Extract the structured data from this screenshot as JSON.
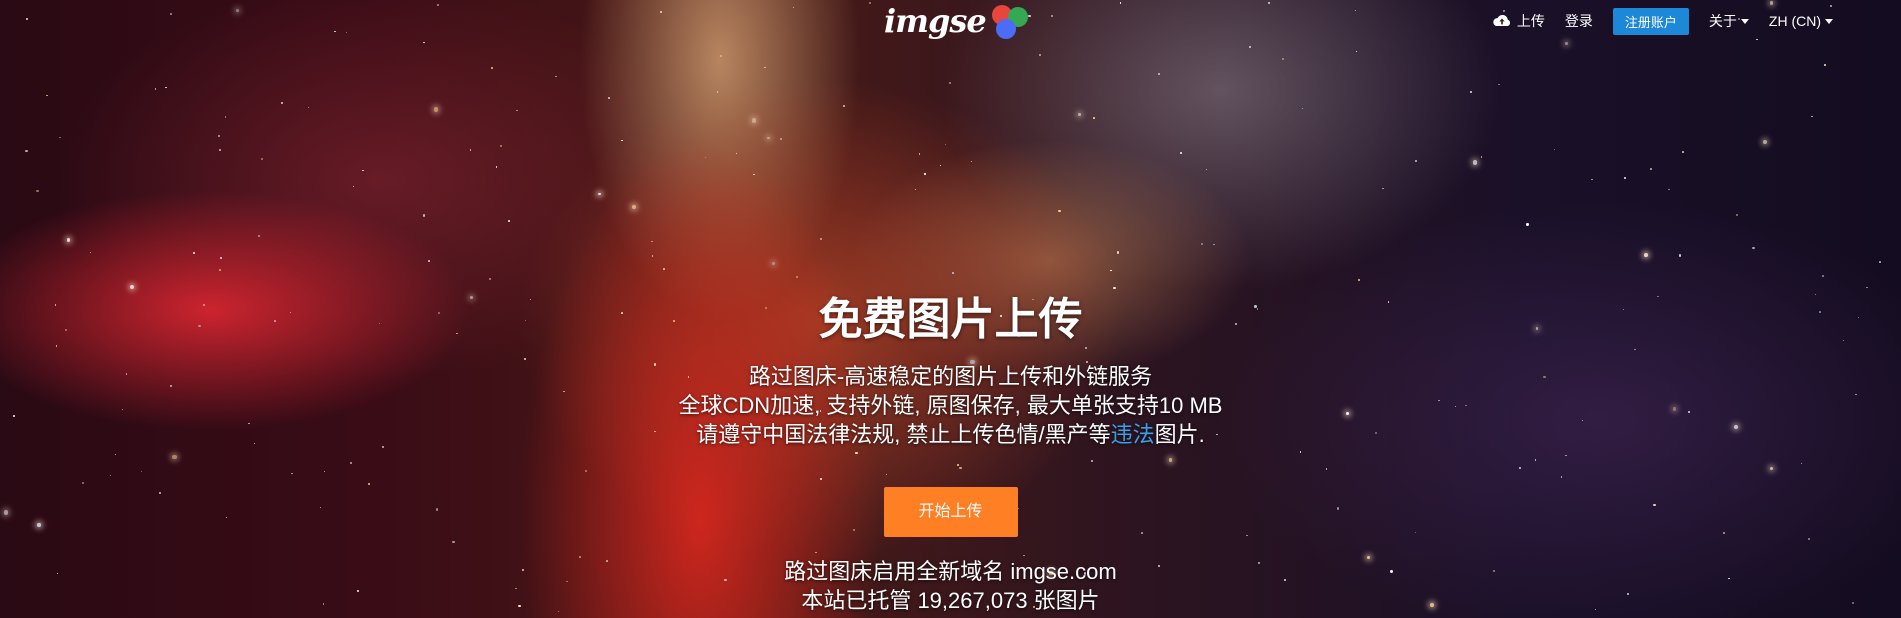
{
  "brand": {
    "logo_text": "imgse",
    "dot_colors": [
      "#e8453c",
      "#34a853",
      "#4a6cf7"
    ]
  },
  "nav": {
    "upload": "上传",
    "login": "登录",
    "register": "注册账户",
    "about": "关于",
    "language": "ZH (CN)"
  },
  "hero": {
    "title": "免费图片上传",
    "line1": "路过图床-高速稳定的图片上传和外链服务",
    "line2": "全球CDN加速, 支持外链, 原图保存, 最大单张支持10 MB",
    "line3_prefix": "请遵守中国法律法规, 禁止上传色情/黑产等",
    "line3_link": "违法",
    "line3_suffix": "图片.",
    "start_button": "开始上传",
    "domain_notice": "路过图床启用全新域名 imgse.com",
    "hosted_count": "本站已托管 19,267,073 张图片"
  },
  "colors": {
    "accent_orange": "#ff7f24",
    "register_blue": "#1d87d8",
    "link_blue": "#3aa0e8"
  }
}
